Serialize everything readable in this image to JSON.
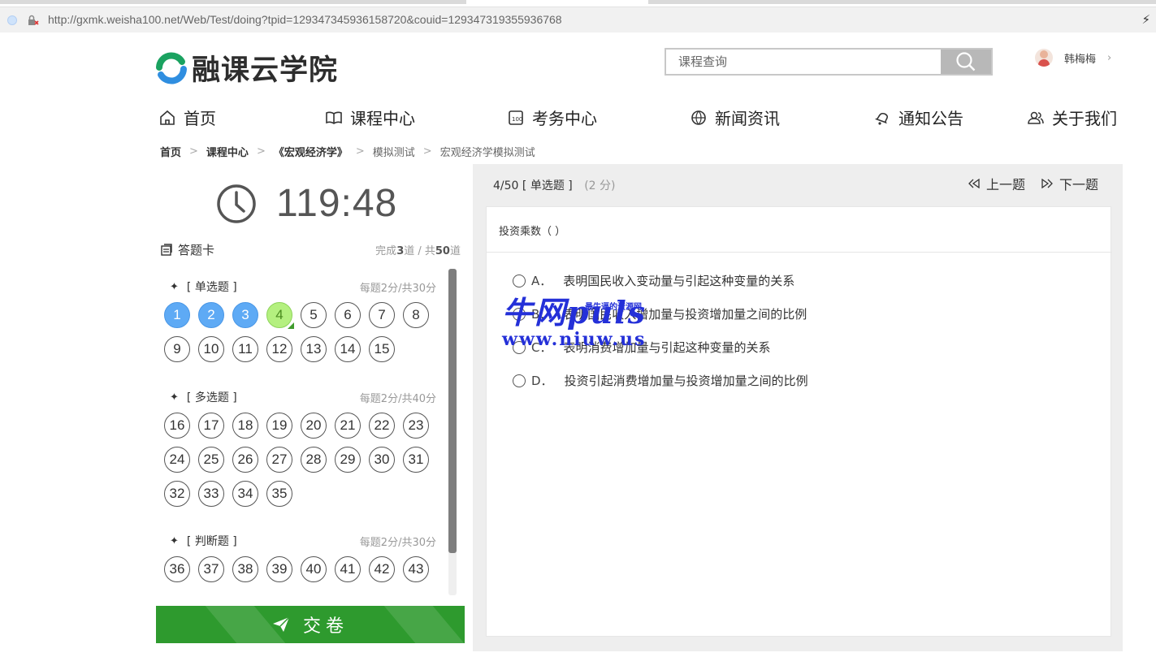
{
  "browser": {
    "url": "http://gxmk.weisha100.net/Web/Test/doing?tpid=129347345936158720&couid=129347319355936768"
  },
  "site": {
    "logo_text": "融课云学院",
    "search_placeholder": "课程查询",
    "user_name": "韩梅梅",
    "nav": [
      "首页",
      "课程中心",
      "考务中心",
      "新闻资讯",
      "通知公告",
      "关于我们"
    ],
    "breadcrumb": [
      "首页",
      "课程中心",
      "《宏观经济学》",
      "模拟测试",
      "宏观经济学模拟测试"
    ]
  },
  "exam": {
    "timer": "119:48",
    "card_title": "答题卡",
    "progress_prefix": "完成",
    "completed": "3",
    "progress_mid": "道 / 共",
    "total": "50",
    "progress_suffix": "道",
    "sections": [
      {
        "title": "[ 单选题 ]",
        "score": "每题2分/共30分",
        "numbers": [
          "1",
          "2",
          "3",
          "4",
          "5",
          "6",
          "7",
          "8",
          "9",
          "10",
          "11",
          "12",
          "13",
          "14",
          "15"
        ],
        "done": [
          1,
          2,
          3
        ],
        "current": 4
      },
      {
        "title": "[ 多选题 ]",
        "score": "每题2分/共40分",
        "numbers": [
          "16",
          "17",
          "18",
          "19",
          "20",
          "21",
          "22",
          "23",
          "24",
          "25",
          "26",
          "27",
          "28",
          "29",
          "30",
          "31",
          "32",
          "33",
          "34",
          "35"
        ],
        "done": [],
        "current": null
      },
      {
        "title": "[ 判断题 ]",
        "score": "每题2分/共30分",
        "numbers": [
          "36",
          "37",
          "38",
          "39",
          "40",
          "41",
          "42",
          "43"
        ],
        "done": [],
        "current": null
      }
    ],
    "submit_label": "交卷"
  },
  "question": {
    "position": "4/50",
    "type": "[ 单选题 ]",
    "points": "(2 分)",
    "prev_label": "上一题",
    "next_label": "下一题",
    "stem": "投资乘数（ ）",
    "options": [
      {
        "key": "A．",
        "text": "表明国民收入变动量与引起这种变量的关系"
      },
      {
        "key": "B．",
        "text": "表明国民收入增加量与投资增加量之间的比例"
      },
      {
        "key": "C．",
        "text": "表明消费增加量与引起这种变量的关系"
      },
      {
        "key": "D．",
        "text": "投资引起消费增加量与投资增加量之间的比例"
      }
    ]
  },
  "watermark": {
    "line1": "牛网puls",
    "line2": "www.niuw.us",
    "small": "最牛逼的资源网"
  },
  "colors": {
    "answered": "#5eaaf5",
    "current": "#b4f07f",
    "submit": "#2e9a2e",
    "watermark": "#2430d8"
  }
}
